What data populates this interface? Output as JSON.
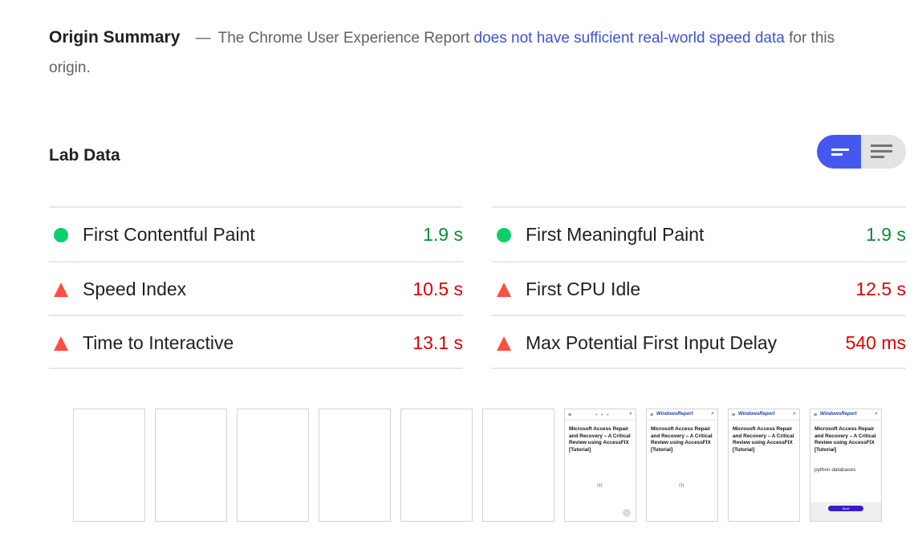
{
  "origin_summary": {
    "title": "Origin Summary",
    "dash": "—",
    "text_before": "The Chrome User Experience Report",
    "link_text": "does not have sufficient real-world speed data",
    "text_after": "for this origin."
  },
  "lab_data": {
    "title": "Lab Data",
    "view_toggle": {
      "selected": "summary",
      "options": [
        "bars-icon",
        "list-icon"
      ],
      "accent": "#4458f0"
    },
    "metrics_left": [
      {
        "label": "First Contentful Paint",
        "value": "1.9 s",
        "status": "pass"
      },
      {
        "label": "Speed Index",
        "value": "10.5 s",
        "status": "fail"
      },
      {
        "label": "Time to Interactive",
        "value": "13.1 s",
        "status": "fail"
      }
    ],
    "metrics_right": [
      {
        "label": "First Meaningful Paint",
        "value": "1.9 s",
        "status": "pass"
      },
      {
        "label": "First CPU Idle",
        "value": "12.5 s",
        "status": "fail"
      },
      {
        "label": "Max Potential First Input Delay",
        "value": "540 ms",
        "status": "fail"
      }
    ],
    "colors": {
      "pass": "#0cce6b",
      "fail": "#ff4e42"
    }
  },
  "filmstrip": {
    "frames": [
      {
        "state": "blank"
      },
      {
        "state": "blank"
      },
      {
        "state": "blank"
      },
      {
        "state": "blank"
      },
      {
        "state": "blank"
      },
      {
        "state": "blank"
      },
      {
        "state": "loading-header"
      },
      {
        "state": "header"
      },
      {
        "state": "header"
      },
      {
        "state": "full"
      }
    ],
    "header_menu": "≡",
    "header_dots": "• • •",
    "header_logo": "WindowsReport",
    "header_search": "⌕",
    "article_title": "Microsoft Access Repair and Recovery – A Critical Review using AccessFIX [Tutorial]",
    "spinner": "m",
    "subheading": "python databases",
    "cta": "Start"
  }
}
